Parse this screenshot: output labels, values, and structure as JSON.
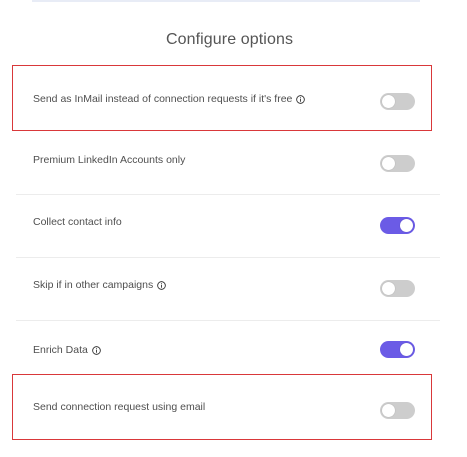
{
  "section": {
    "title": "Configure options"
  },
  "options": [
    {
      "label": "Send as InMail instead of connection requests if it's free",
      "info": true,
      "enabled": false,
      "highlighted": true
    },
    {
      "label": "Premium LinkedIn Accounts only",
      "info": false,
      "enabled": false,
      "highlighted": false
    },
    {
      "label": "Collect contact info",
      "info": false,
      "enabled": true,
      "highlighted": false
    },
    {
      "label": "Skip if in other campaigns",
      "info": true,
      "enabled": false,
      "highlighted": false
    },
    {
      "label": "Enrich Data",
      "info": true,
      "enabled": true,
      "highlighted": false
    },
    {
      "label": "Send connection request using email",
      "info": false,
      "enabled": false,
      "highlighted": true
    }
  ],
  "colors": {
    "toggle_on": "#6b5be6",
    "toggle_off": "#cdcdcd",
    "highlight": "#d9383a"
  }
}
